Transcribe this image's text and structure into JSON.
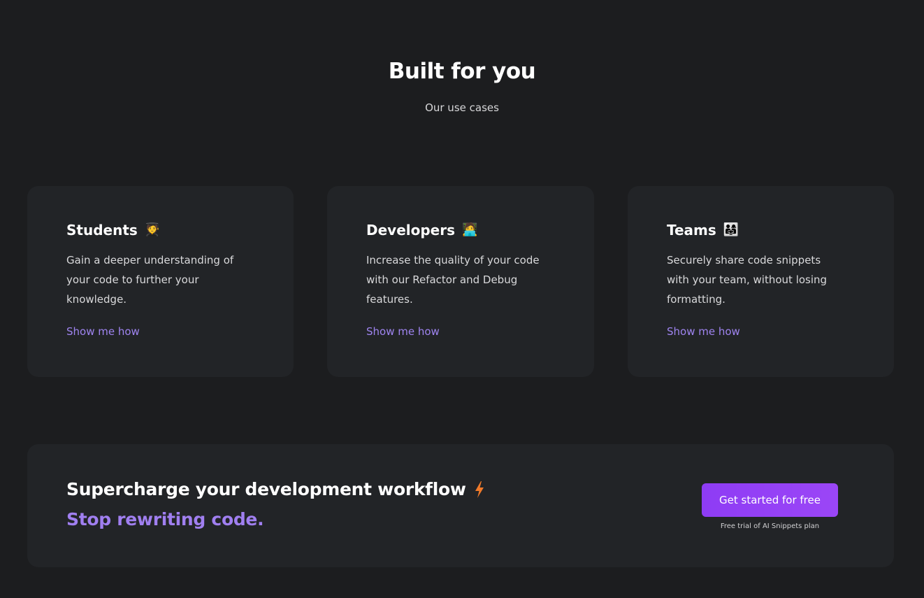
{
  "hero": {
    "title": "Built for you",
    "subtitle": "Our use cases"
  },
  "cards": [
    {
      "title": "Students",
      "emoji": "🧑‍🎓",
      "emoji_name": "student-icon",
      "description": "Gain a deeper understanding of your code to further your knowledge.",
      "link": "Show me how"
    },
    {
      "title": "Developers",
      "emoji": "🧑‍💻",
      "emoji_name": "developer-icon",
      "description": "Increase the quality of your code with our Refactor and Debug features.",
      "link": "Show me how"
    },
    {
      "title": "Teams",
      "emoji": "👨‍👩‍👧",
      "emoji_name": "team-icon",
      "description": "Securely share code snippets with your team, without losing formatting.",
      "link": "Show me how"
    }
  ],
  "banner": {
    "title": "Supercharge your development workflow",
    "icon": "lightning-bolt-icon",
    "subtitle": "Stop rewriting code.",
    "cta_label": "Get started for free",
    "cta_note": "Free trial of AI Snippets plan"
  },
  "colors": {
    "background": "#1c1d1f",
    "card": "#222427",
    "link": "#9f84f0",
    "accent_text": "#a07ff0",
    "button": "#8e3cf5",
    "bolt": "#f07a2a"
  }
}
